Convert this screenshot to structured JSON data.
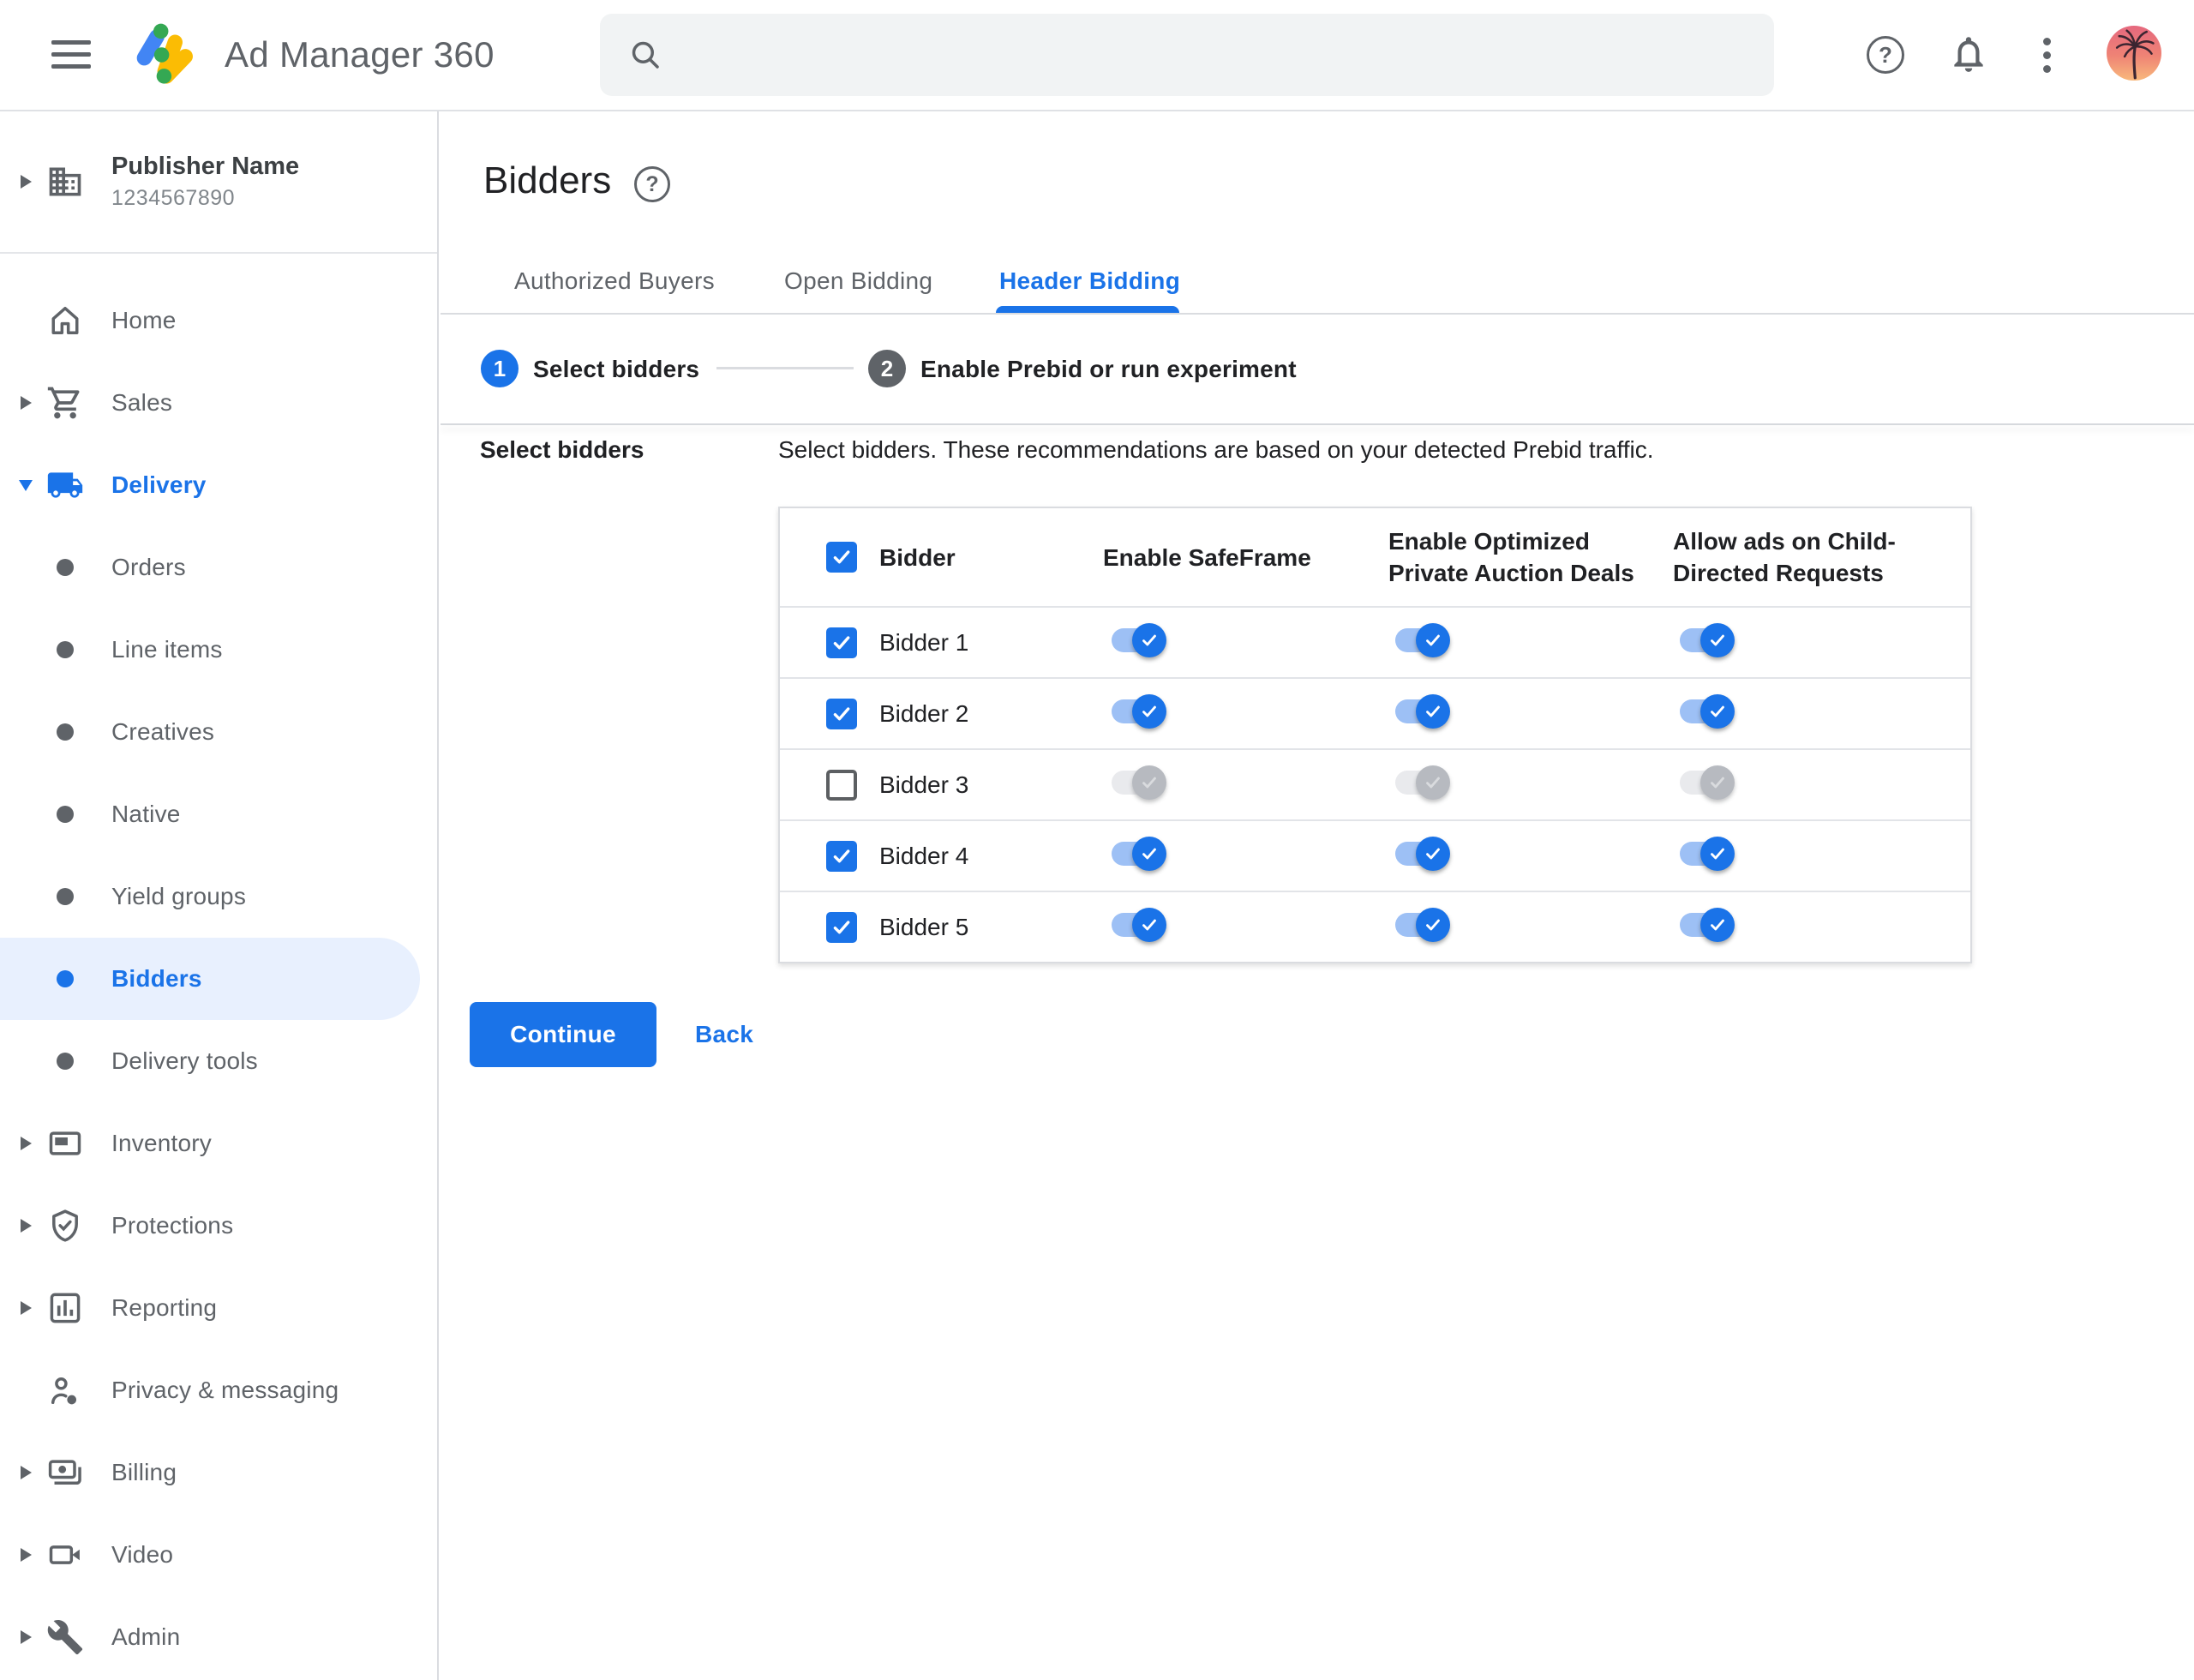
{
  "header": {
    "product_name": "Ad Manager 360",
    "search_value": "",
    "search_placeholder": "",
    "help_glyph": "?"
  },
  "publisher": {
    "name": "Publisher Name",
    "id": "1234567890",
    "icon": "building-icon"
  },
  "sidebar": {
    "items": [
      {
        "label": "Home",
        "icon": "home-icon",
        "level": 0,
        "arrow": "none"
      },
      {
        "label": "Sales",
        "icon": "cart-icon",
        "level": 0,
        "arrow": "collapsed"
      },
      {
        "label": "Delivery",
        "icon": "truck-icon",
        "level": 0,
        "arrow": "expanded",
        "highlight": true
      },
      {
        "label": "Orders",
        "level": 1
      },
      {
        "label": "Line items",
        "level": 1
      },
      {
        "label": "Creatives",
        "level": 1
      },
      {
        "label": "Native",
        "level": 1
      },
      {
        "label": "Yield groups",
        "level": 1
      },
      {
        "label": "Bidders",
        "level": 1,
        "selected": true
      },
      {
        "label": "Delivery tools",
        "level": 1
      },
      {
        "label": "Inventory",
        "icon": "inventory-icon",
        "level": 0,
        "arrow": "collapsed"
      },
      {
        "label": "Protections",
        "icon": "shield-check-icon",
        "level": 0,
        "arrow": "collapsed"
      },
      {
        "label": "Reporting",
        "icon": "bar-chart-icon",
        "level": 0,
        "arrow": "collapsed"
      },
      {
        "label": "Privacy & messaging",
        "icon": "person-privacy-icon",
        "level": 0,
        "arrow": "none"
      },
      {
        "label": "Billing",
        "icon": "money-icon",
        "level": 0,
        "arrow": "collapsed"
      },
      {
        "label": "Video",
        "icon": "video-camera-icon",
        "level": 0,
        "arrow": "collapsed"
      },
      {
        "label": "Admin",
        "icon": "wrench-icon",
        "level": 0,
        "arrow": "collapsed"
      }
    ]
  },
  "page": {
    "title": "Bidders",
    "help_glyph": "?"
  },
  "tabs": [
    {
      "label": "Authorized Buyers",
      "active": false
    },
    {
      "label": "Open Bidding",
      "active": false
    },
    {
      "label": "Header Bidding",
      "active": true
    }
  ],
  "stepper": [
    {
      "number": "1",
      "label": "Select bidders",
      "state": "active"
    },
    {
      "number": "2",
      "label": "Enable Prebid or run experiment",
      "state": "upcoming"
    }
  ],
  "form": {
    "section_label": "Select bidders",
    "description": "Select bidders. These recommendations are based on your detected Prebid traffic."
  },
  "table": {
    "select_all_checked": true,
    "columns": [
      "Bidder",
      "Enable SafeFrame",
      "Enable Optimized Private Auction Deals",
      "Allow ads on Child-Directed Requests"
    ],
    "rows": [
      {
        "name": "Bidder 1",
        "checked": true,
        "toggles": [
          true,
          true,
          true
        ]
      },
      {
        "name": "Bidder 2",
        "checked": true,
        "toggles": [
          true,
          true,
          true
        ]
      },
      {
        "name": "Bidder 3",
        "checked": false,
        "toggles": [
          false,
          false,
          false
        ]
      },
      {
        "name": "Bidder 4",
        "checked": true,
        "toggles": [
          true,
          true,
          true
        ]
      },
      {
        "name": "Bidder 5",
        "checked": true,
        "toggles": [
          true,
          true,
          true
        ]
      }
    ]
  },
  "actions": {
    "continue_label": "Continue",
    "back_label": "Back"
  },
  "colors": {
    "accent": "#1a73e8",
    "selected_item_bg": "#e8f0fe",
    "toggle_on_track": "#9dc0f5",
    "toggle_off_thumb": "#b7bac0",
    "logo_blue": "#4285f4",
    "logo_yellow": "#fbbc04",
    "logo_green": "#34a853"
  }
}
